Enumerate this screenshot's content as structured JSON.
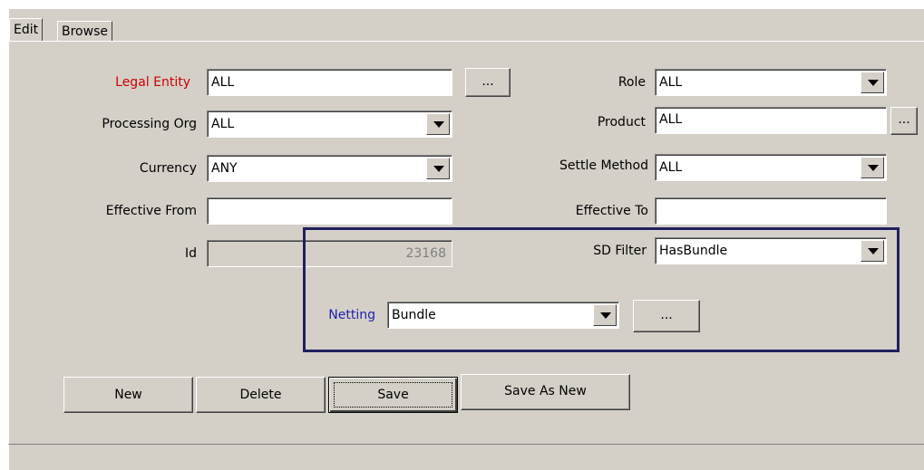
{
  "tabs": {
    "edit": "Edit",
    "browse": "Browse"
  },
  "form": {
    "legal_entity": {
      "label": "Legal Entity",
      "value": "ALL",
      "browse": "..."
    },
    "processing_org": {
      "label": "Processing Org",
      "value": "ALL"
    },
    "currency": {
      "label": "Currency",
      "value": "ANY"
    },
    "effective_from": {
      "label": "Effective From",
      "value": ""
    },
    "id": {
      "label": "Id",
      "value": "23168"
    },
    "role": {
      "label": "Role",
      "value": "ALL"
    },
    "product": {
      "label": "Product",
      "value": "ALL",
      "browse": "..."
    },
    "settle_method": {
      "label": "Settle Method",
      "value": "ALL"
    },
    "effective_to": {
      "label": "Effective To",
      "value": ""
    },
    "sd_filter": {
      "label": "SD Filter",
      "value": "HasBundle"
    },
    "netting": {
      "label": "Netting",
      "value": "Bundle",
      "browse": "..."
    }
  },
  "buttons": {
    "new": "New",
    "delete": "Delete",
    "save": "Save",
    "save_as_new": "Save As New"
  },
  "colors": {
    "legal_entity_label": "#cc0000",
    "netting_label": "#2020b0",
    "highlight_border": "#202060"
  }
}
